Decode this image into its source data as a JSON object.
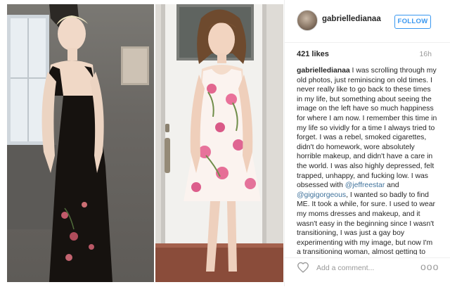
{
  "post": {
    "username": "gabrielledianaa",
    "follow_label": "FOLLOW",
    "likes": "421 likes",
    "time": "16h",
    "caption_user": "gabrielledianaa",
    "caption_part1": " I was scrolling through my old photos, just reminiscing on old times. I never really like to go back to these times in my life, but something about seeing the image on the left have so much happiness for where I am now. I remember this time in my life so vividly for a time I always tried to forget. I was a rebel, smoked cigarettes, didn't do homework, wore absolutely horrible makeup, and didn't have a care in the world. I was also highly depressed, felt trapped, unhappy, and fucking low. I was obsessed with ",
    "mention1": "@jeffreestar",
    "caption_part2": " and ",
    "mention2": "@gigigorgeous",
    "caption_part3": ", I wanted so badly to find ME. It took a while, for sure. I used to wear my moms dresses and makeup, and it wasn't easy in the beginning since I wasn't transitioning, I was just a gay boy experimenting with my image, but now I'm a transitioning woman, almost getting to the next step of a major surgery that I never imagined would be in the cards. I thought",
    "add_comment_placeholder": "Add a comment...",
    "more_label": "ooo"
  },
  "colors": {
    "accent": "#3897f0",
    "mention": "#3f729b",
    "muted": "#999999"
  }
}
